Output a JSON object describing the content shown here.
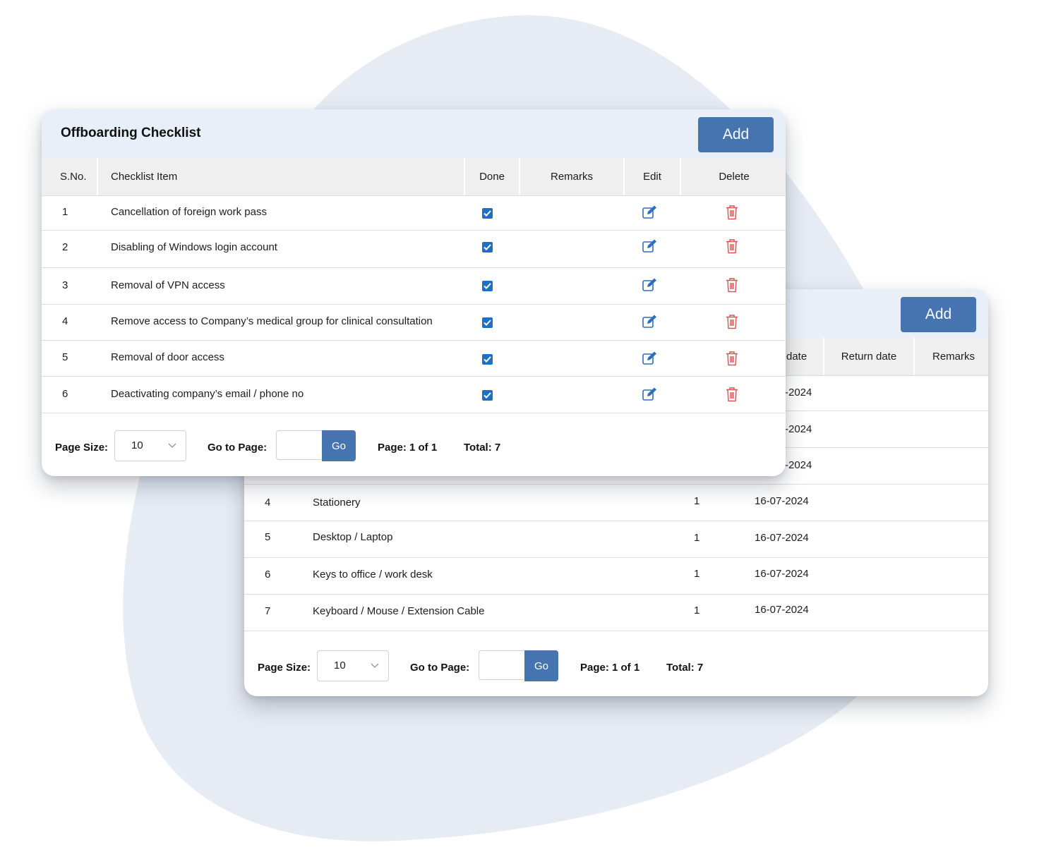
{
  "colors": {
    "accent": "#4674b0",
    "header_bg": "#e8eff8",
    "blob": "#e7ebf3",
    "delete_icon": "#d9534f",
    "edit_icon": "#2f6ebb"
  },
  "front": {
    "title": "Offboarding Checklist",
    "add_label": "Add",
    "columns": [
      "S.No.",
      "Checklist Item",
      "Done",
      "Remarks",
      "Edit",
      "Delete"
    ],
    "rows": [
      {
        "sno": "1",
        "item": "Cancellation of foreign work pass",
        "done": true,
        "remarks": ""
      },
      {
        "sno": "2",
        "item": "Disabling of Windows login account",
        "done": true,
        "remarks": ""
      },
      {
        "sno": "3",
        "item": "Removal of VPN access",
        "done": true,
        "remarks": ""
      },
      {
        "sno": "4",
        "item": "Remove access to Company’s medical group for clinical consultation",
        "done": true,
        "remarks": ""
      },
      {
        "sno": "5",
        "item": "Removal of door access",
        "done": true,
        "remarks": ""
      },
      {
        "sno": "6",
        "item": "Deactivating company’s email / phone no",
        "done": true,
        "remarks": ""
      }
    ],
    "footer": {
      "page_size_label": "Page Size:",
      "page_size_value": "10",
      "goto_label": "Go to Page:",
      "go_label": "Go",
      "page_info": "Page: 1 of 1",
      "total": "Total: 7"
    }
  },
  "back": {
    "add_label": "Add",
    "visible_columns": [
      "date",
      "Return date",
      "Remarks"
    ],
    "partial_rows": [
      {
        "date_fragment": "-2024"
      },
      {
        "date_fragment": "-2024"
      },
      {
        "date_fragment": "-2024"
      }
    ],
    "rows": [
      {
        "sno": "4",
        "item": "Stationery",
        "qty": "1",
        "date": "16-07-2024"
      },
      {
        "sno": "5",
        "item": "Desktop / Laptop",
        "qty": "1",
        "date": "16-07-2024"
      },
      {
        "sno": "6",
        "item": "Keys to office / work desk",
        "qty": "1",
        "date": "16-07-2024"
      },
      {
        "sno": "7",
        "item": "Keyboard / Mouse / Extension Cable",
        "qty": "1",
        "date": "16-07-2024"
      }
    ],
    "footer": {
      "page_size_label": "Page Size:",
      "page_size_value": "10",
      "goto_label": "Go to Page:",
      "go_label": "Go",
      "page_info": "Page: 1 of 1",
      "total": "Total: 7"
    }
  }
}
